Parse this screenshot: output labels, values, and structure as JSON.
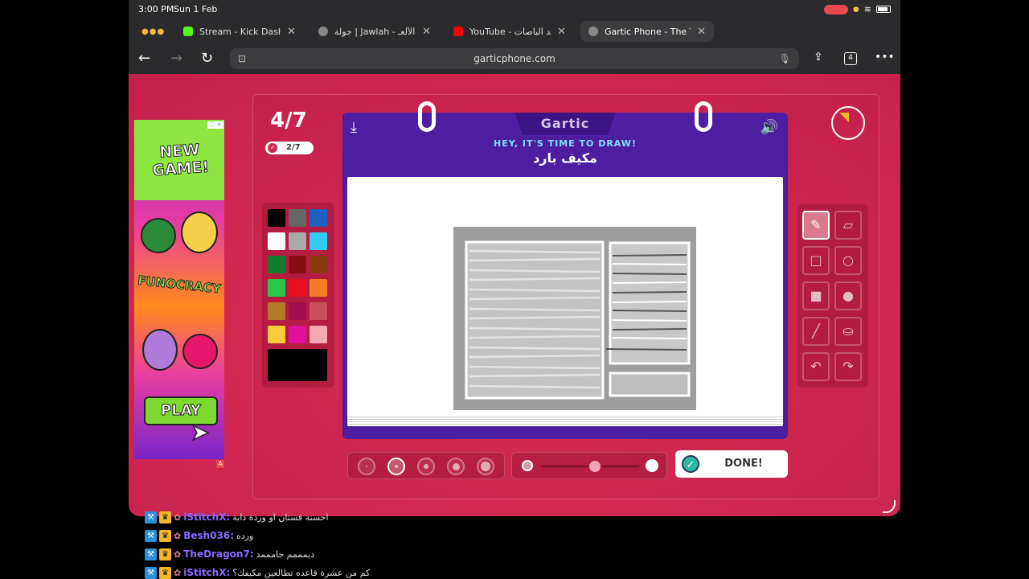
{
  "status": {
    "time": "3:00 PM",
    "date": "Sun 1 Feb"
  },
  "tabs": [
    {
      "title": "Stream - Kick Dashboar",
      "favicon_color": "#53fc18",
      "active": false
    },
    {
      "title": "جولة | Jawlah - منصة الألعـ",
      "favicon_color": "#888888",
      "active": false
    },
    {
      "title": "YouTube - تجديد الباصات!",
      "favicon_color": "#ff0000",
      "active": false
    },
    {
      "title": "Gartic Phone - The Teleg",
      "favicon_color": "#888888",
      "active": true
    }
  ],
  "browser": {
    "url": "garticphone.com",
    "tab_count": "4"
  },
  "ad": {
    "headline": "NEW GAME!",
    "brand": "FUNOCRACY",
    "cta": "PLAY",
    "flag": "A"
  },
  "game": {
    "round": "4/7",
    "completed": "2/7",
    "logo": "Gartic",
    "prompt_title": "HEY, IT'S TIME TO DRAW!",
    "word": "مكيف بارد",
    "done_label": "DONE!",
    "palette": [
      "#000000",
      "#666666",
      "#1f5fbf",
      "#ffffff",
      "#aaaaaa",
      "#33ccf5",
      "#137a2e",
      "#8a0a16",
      "#8c3a10",
      "#29c84a",
      "#e8101c",
      "#f47a23",
      "#b37a2a",
      "#a01050",
      "#c9505a",
      "#fccb3a",
      "#e0109a",
      "#f7a8b0"
    ],
    "current_color": "#000000",
    "tools": [
      "pencil-icon",
      "eraser-icon",
      "rectangle-outline-icon",
      "ellipse-outline-icon",
      "rectangle-fill-icon",
      "ellipse-fill-icon",
      "line-icon",
      "bucket-icon",
      "undo-icon",
      "redo-icon"
    ],
    "selected_brush_size_index": 1,
    "opacity_level": 0.55
  },
  "chat": [
    {
      "user": "iStitchX",
      "text": "احسنة فستان او وردة دابة",
      "color": "#8a6bff"
    },
    {
      "user": "Besh036",
      "text": "ورده",
      "color": "#8a6bff"
    },
    {
      "user": "TheDragon7",
      "text": "ديمممم جامممد",
      "color": "#8a6bff"
    },
    {
      "user": "iStitchX",
      "text": "كم من عشرة قاعده تطالعين مكيفك؟",
      "color": "#8a6bff"
    }
  ]
}
